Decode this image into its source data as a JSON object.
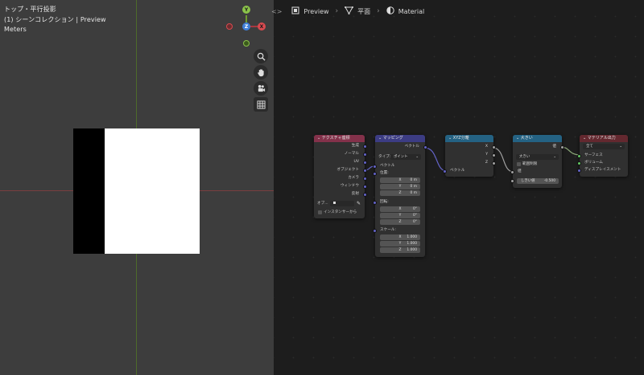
{
  "viewport": {
    "view_name": "トップ・平行投影",
    "collection": "(1) シーンコレクション | Preview",
    "units": "Meters",
    "gizmo": {
      "y": "Y",
      "z": "Z",
      "x": "X"
    },
    "tools": [
      "zoom-icon",
      "hand-pan-icon",
      "camera-icon",
      "grid-icon"
    ]
  },
  "header": {
    "items": [
      {
        "label": "Preview",
        "icon": "object-icon"
      },
      {
        "label": "平面",
        "icon": "mesh-icon"
      },
      {
        "label": "Material",
        "icon": "material-icon"
      }
    ]
  },
  "nodes": {
    "tex_coord": {
      "title": "テクスチャ座標",
      "outputs": [
        "生成",
        "ノーマル",
        "UV",
        "オブジェクト",
        "カメラ",
        "ウィンドウ",
        "反射"
      ],
      "object_label": "オブ...",
      "instancer": "インスタンサーから"
    },
    "mapping": {
      "title": "マッピング",
      "output": "ベクトル",
      "type_label": "タイプ:",
      "type_value": "ポイント",
      "vector": "ベクトル",
      "location": "位置:",
      "loc_values": [
        {
          "axis": "X",
          "value": "0 m"
        },
        {
          "axis": "Y",
          "value": "0 m"
        },
        {
          "axis": "Z",
          "value": "0 m"
        }
      ],
      "rotation": "回転:",
      "rot_values": [
        {
          "axis": "X",
          "value": "0°"
        },
        {
          "axis": "Y",
          "value": "0°"
        },
        {
          "axis": "Z",
          "value": "0°"
        }
      ],
      "scale": "スケール:",
      "scale_values": [
        {
          "axis": "X",
          "value": "1.000"
        },
        {
          "axis": "Y",
          "value": "1.000"
        },
        {
          "axis": "Z",
          "value": "1.000"
        }
      ]
    },
    "separate_xyz": {
      "title": "XYZ分離",
      "outputs": [
        "X",
        "Y",
        "Z"
      ],
      "input": "ベクトル"
    },
    "math": {
      "title": "大きい",
      "output": "値",
      "operation": "大きい",
      "clamp": "範囲制限",
      "input": "値",
      "threshold_label": "しきい値",
      "threshold_value": "-0.500"
    },
    "output": {
      "title": "マテリアル出力",
      "target": "全て",
      "inputs": [
        "サーフェス",
        "ボリューム",
        "ディスプレイスメント"
      ]
    }
  },
  "colors": {
    "input_header": "#83314a",
    "vector_header": "#3c3c83",
    "converter_header": "#246283",
    "output_header": "#63282f",
    "vector_socket": "#6363c7",
    "color_socket": "#c7c729",
    "value_socket": "#a1a1a1",
    "shader_socket": "#63c763"
  }
}
